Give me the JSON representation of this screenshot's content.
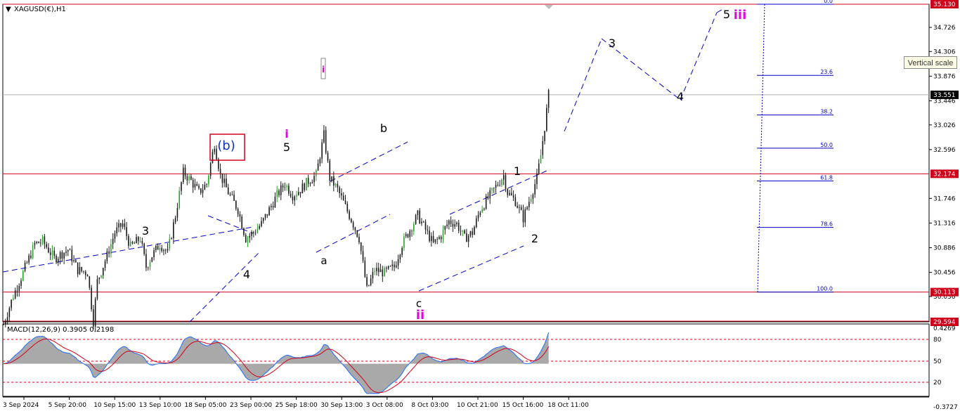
{
  "symbol_label": "XAGUSD(€),H1",
  "macd_label": "MACD(12,26,9) 0.3905 0.2198",
  "tooltip": "Vertical scale",
  "colors": {
    "candle": "#1a1a1a",
    "bull": "#2aa52a",
    "hline": "#d0021b",
    "trend": "#0000c8",
    "fib": "#0000c8",
    "macd_line": "#d0021b",
    "histo": "#a9a9a9",
    "signal": "#1e6bff",
    "wave_pink": "#e600e6",
    "wave_blue": "#1030c8"
  },
  "chart_data": [
    {
      "type": "candlestick",
      "y_range": [
        29.594,
        35.13
      ],
      "x_tick_labels": [
        "3 Sep 2024",
        "5 Sep 20:00",
        "10 Sep 15:00",
        "13 Sep 10:00",
        "18 Sep 05:00",
        "23 Sep 00:00",
        "25 Sep 18:00",
        "30 Sep 13:00",
        "3 Oct 08:00",
        "8 Oct 03:00",
        "10 Oct 21:00",
        "15 Oct 16:00",
        "18 Oct 11:00"
      ],
      "y_tick_labels": [
        "34.726",
        "34.306",
        "33.876",
        "33.446",
        "33.026",
        "32.596",
        "31.746",
        "31.316",
        "30.886",
        "30.456",
        "30.036"
      ],
      "price_boxes": [
        {
          "label": "35.130",
          "value": 35.13,
          "bg": "#d0021b"
        },
        {
          "label": "33.551",
          "value": 33.551,
          "bg": "#000000"
        },
        {
          "label": "32.174",
          "value": 32.174,
          "bg": "#d0021b"
        },
        {
          "label": "30.113",
          "value": 30.113,
          "bg": "#d0021b"
        },
        {
          "label": "29.594",
          "value": 29.594,
          "bg": "#d0021b"
        }
      ],
      "horizontal_lines": [
        35.13,
        32.174,
        30.113
      ],
      "current_price": 33.551,
      "key_points": [
        {
          "t": 0,
          "p": 29.55
        },
        {
          "t": 5,
          "p": 30.05
        },
        {
          "t": 10,
          "p": 30.45
        },
        {
          "t": 16,
          "p": 30.95
        },
        {
          "t": 20,
          "p": 31.0
        },
        {
          "t": 26,
          "p": 30.7
        },
        {
          "t": 33,
          "p": 30.85
        },
        {
          "t": 38,
          "p": 30.5
        },
        {
          "t": 43,
          "p": 30.45
        },
        {
          "t": 46,
          "p": 29.6
        },
        {
          "t": 48,
          "p": 30.3
        },
        {
          "t": 53,
          "p": 30.75
        },
        {
          "t": 57,
          "p": 31.15
        },
        {
          "t": 61,
          "p": 31.3
        },
        {
          "t": 65,
          "p": 30.9
        },
        {
          "t": 70,
          "p": 31.05
        },
        {
          "t": 73,
          "p": 30.55
        },
        {
          "t": 76,
          "p": 30.75
        },
        {
          "t": 80,
          "p": 30.95
        },
        {
          "t": 84,
          "p": 30.8
        },
        {
          "t": 88,
          "p": 31.45
        },
        {
          "t": 92,
          "p": 32.2
        },
        {
          "t": 96,
          "p": 32.05
        },
        {
          "t": 100,
          "p": 31.85
        },
        {
          "t": 104,
          "p": 32.0
        },
        {
          "t": 108,
          "p": 32.7
        },
        {
          "t": 111,
          "p": 32.15
        },
        {
          "t": 115,
          "p": 31.85
        },
        {
          "t": 120,
          "p": 31.55
        },
        {
          "t": 124,
          "p": 31.05
        },
        {
          "t": 128,
          "p": 31.15
        },
        {
          "t": 132,
          "p": 31.3
        },
        {
          "t": 136,
          "p": 31.55
        },
        {
          "t": 140,
          "p": 31.8
        },
        {
          "t": 144,
          "p": 32.0
        },
        {
          "t": 148,
          "p": 31.8
        },
        {
          "t": 152,
          "p": 31.9
        },
        {
          "t": 156,
          "p": 32.05
        },
        {
          "t": 160,
          "p": 32.15
        },
        {
          "t": 164,
          "p": 32.85
        },
        {
          "t": 167,
          "p": 32.1
        },
        {
          "t": 171,
          "p": 31.9
        },
        {
          "t": 175,
          "p": 31.6
        },
        {
          "t": 179,
          "p": 31.3
        },
        {
          "t": 182,
          "p": 31.05
        },
        {
          "t": 186,
          "p": 30.15
        },
        {
          "t": 190,
          "p": 30.5
        },
        {
          "t": 195,
          "p": 30.45
        },
        {
          "t": 200,
          "p": 30.55
        },
        {
          "t": 204,
          "p": 30.95
        },
        {
          "t": 208,
          "p": 31.2
        },
        {
          "t": 212,
          "p": 31.45
        },
        {
          "t": 216,
          "p": 31.2
        },
        {
          "t": 220,
          "p": 30.95
        },
        {
          "t": 224,
          "p": 31.1
        },
        {
          "t": 228,
          "p": 31.35
        },
        {
          "t": 232,
          "p": 31.3
        },
        {
          "t": 236,
          "p": 31.05
        },
        {
          "t": 240,
          "p": 31.15
        },
        {
          "t": 244,
          "p": 31.55
        },
        {
          "t": 248,
          "p": 31.75
        },
        {
          "t": 252,
          "p": 31.95
        },
        {
          "t": 256,
          "p": 32.15
        },
        {
          "t": 258,
          "p": 31.85
        },
        {
          "t": 262,
          "p": 31.7
        },
        {
          "t": 266,
          "p": 31.4
        },
        {
          "t": 268,
          "p": 31.6
        },
        {
          "t": 271,
          "p": 31.9
        },
        {
          "t": 273,
          "p": 32.1
        },
        {
          "t": 275,
          "p": 32.5
        },
        {
          "t": 277,
          "p": 33.0
        },
        {
          "t": 279,
          "p": 33.55
        }
      ],
      "fibonacci": [
        {
          "level": "0.0",
          "price": 35.13
        },
        {
          "level": "23.6",
          "price": 33.89
        },
        {
          "level": "38.2",
          "price": 33.2
        },
        {
          "level": "50.0",
          "price": 32.62
        },
        {
          "level": "61.8",
          "price": 32.05
        },
        {
          "level": "78.6",
          "price": 31.24
        },
        {
          "level": "100.0",
          "price": 30.113
        }
      ],
      "wave_labels": [
        {
          "text": "3",
          "color": "black"
        },
        {
          "text": "4",
          "color": "black"
        },
        {
          "text": "5",
          "color": "black"
        },
        {
          "text": "i",
          "color": "pink"
        },
        {
          "text": "i",
          "color": "pink"
        },
        {
          "text": "(b)",
          "color": "blue"
        },
        {
          "text": "a",
          "color": "black"
        },
        {
          "text": "b",
          "color": "black"
        },
        {
          "text": "c",
          "color": "black"
        },
        {
          "text": "ii",
          "color": "pink"
        },
        {
          "text": "1",
          "color": "black"
        },
        {
          "text": "2",
          "color": "black"
        },
        {
          "text": "3",
          "color": "black"
        },
        {
          "text": "4",
          "color": "black"
        },
        {
          "text": "5",
          "color": "black"
        },
        {
          "text": "iii",
          "color": "pink"
        }
      ]
    },
    {
      "type": "macd",
      "title": "MACD(12,26,9) 0.3905 0.2198",
      "params": [
        12,
        26,
        9
      ],
      "last_macd": 0.3905,
      "last_signal": 0.2198,
      "y_tick_labels": [
        "0.4269",
        "80",
        "50",
        "20",
        "-0.3727"
      ],
      "levels": [
        80,
        50,
        20
      ]
    }
  ]
}
